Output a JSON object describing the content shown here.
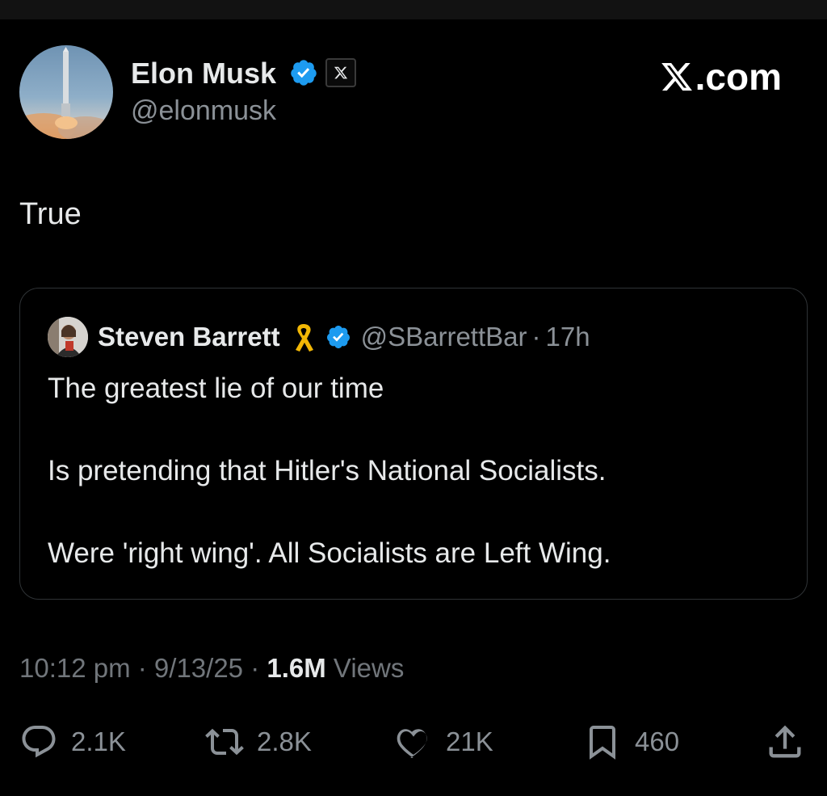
{
  "author": {
    "name": "Elon Musk",
    "handle": "@elonmusk"
  },
  "watermark": {
    "label": ".com"
  },
  "tweet": {
    "text": "True"
  },
  "quoted": {
    "name": "Steven Barrett",
    "handle": "@SBarrettBar",
    "separator": "·",
    "time": "17h",
    "lines": [
      "The greatest lie of our time",
      "Is pretending that Hitler's National Socialists.",
      "Were 'right wing'. All Socialists are Left Wing."
    ]
  },
  "meta": {
    "time": "10:12 pm",
    "sep1": " · ",
    "date": "9/13/25",
    "sep2": " · ",
    "views_count": "1.6M",
    "views_label": " Views"
  },
  "actions": {
    "replies": "2.1K",
    "reposts": "2.8K",
    "likes": "21K",
    "bookmarks": "460"
  },
  "colors": {
    "background": "#000000",
    "text": "#e7e9ea",
    "secondary": "#8b9197",
    "verified": "#1d9bf0",
    "ribbon": "#f2b705",
    "border": "#2f3336"
  },
  "icons": {
    "verified": "verified-badge-icon",
    "affiliate": "x-logo-icon",
    "ribbon": "awareness-ribbon-icon",
    "reply": "reply-icon",
    "repost": "repost-icon",
    "like": "heart-icon",
    "bookmark": "bookmark-icon",
    "share": "share-icon"
  }
}
